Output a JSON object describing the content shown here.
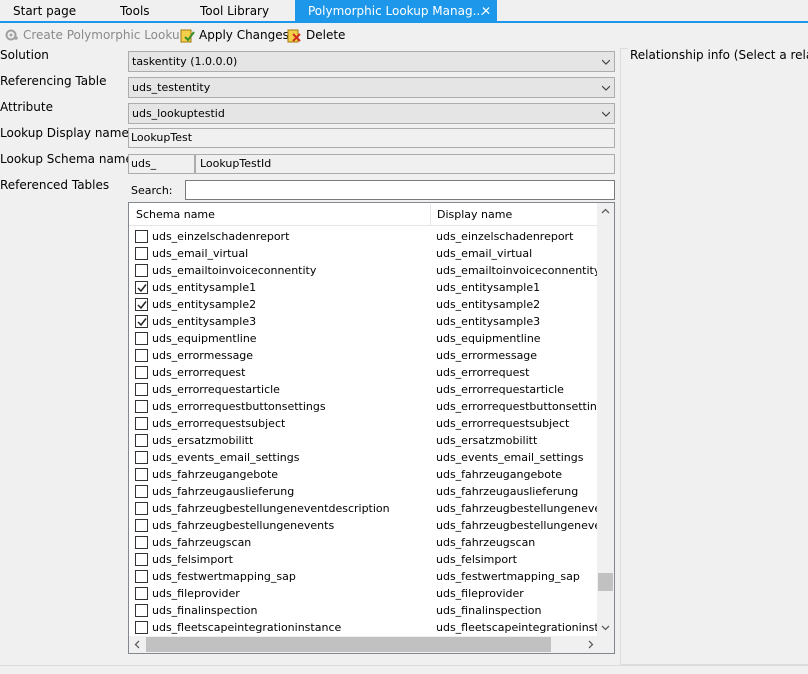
{
  "tabs": [
    {
      "label": "Start page",
      "active": false
    },
    {
      "label": "Tools",
      "active": false
    },
    {
      "label": "Tool Library",
      "active": false
    },
    {
      "label": "Polymorphic Lookup Manag...",
      "active": true
    }
  ],
  "toolbar": {
    "create_label": "Create Polymorphic Lookup",
    "apply_label": "Apply Changes",
    "delete_label": "Delete"
  },
  "form": {
    "solution_label": "Solution",
    "solution_value": "taskentity (1.0.0.0)",
    "referencing_label": "Referencing Table",
    "referencing_value": "uds_testentity",
    "attribute_label": "Attribute",
    "attribute_value": "uds_lookuptestid",
    "display_name_label": "Lookup Display name",
    "display_name_value": "LookupTest",
    "schema_name_label": "Lookup Schema name",
    "schema_prefix": "uds_",
    "schema_name_value": "LookupTestId",
    "referenced_tables_label": "Referenced Tables",
    "search_label": "Search:",
    "search_value": ""
  },
  "list": {
    "columns": [
      "Schema name",
      "Display name"
    ],
    "rows": [
      {
        "schema": "uds_einzelschadenreport",
        "display": "uds_einzelschadenreport",
        "checked": false
      },
      {
        "schema": "uds_email_virtual",
        "display": "uds_email_virtual",
        "checked": false
      },
      {
        "schema": "uds_emailtoinvoiceconnentity",
        "display": "uds_emailtoinvoiceconnentity",
        "checked": false
      },
      {
        "schema": "uds_entitysample1",
        "display": "uds_entitysample1",
        "checked": true
      },
      {
        "schema": "uds_entitysample2",
        "display": "uds_entitysample2",
        "checked": true
      },
      {
        "schema": "uds_entitysample3",
        "display": "uds_entitysample3",
        "checked": true
      },
      {
        "schema": "uds_equipmentline",
        "display": "uds_equipmentline",
        "checked": false
      },
      {
        "schema": "uds_errormessage",
        "display": "uds_errormessage",
        "checked": false
      },
      {
        "schema": "uds_errorrequest",
        "display": "uds_errorrequest",
        "checked": false
      },
      {
        "schema": "uds_errorrequestarticle",
        "display": "uds_errorrequestarticle",
        "checked": false
      },
      {
        "schema": "uds_errorrequestbuttonsettings",
        "display": "uds_errorrequestbuttonsettings",
        "checked": false
      },
      {
        "schema": "uds_errorrequestsubject",
        "display": "uds_errorrequestsubject",
        "checked": false
      },
      {
        "schema": "uds_ersatzmobilitt",
        "display": "uds_ersatzmobilitt",
        "checked": false
      },
      {
        "schema": "uds_events_email_settings",
        "display": "uds_events_email_settings",
        "checked": false
      },
      {
        "schema": "uds_fahrzeugangebote",
        "display": "uds_fahrzeugangebote",
        "checked": false
      },
      {
        "schema": "uds_fahrzeugauslieferung",
        "display": "uds_fahrzeugauslieferung",
        "checked": false
      },
      {
        "schema": "uds_fahrzeugbestellungeneventdescription",
        "display": "uds_fahrzeugbestellungeneventde",
        "checked": false
      },
      {
        "schema": "uds_fahrzeugbestellungenevents",
        "display": "uds_fahrzeugbestellungenevents",
        "checked": false
      },
      {
        "schema": "uds_fahrzeugscan",
        "display": "uds_fahrzeugscan",
        "checked": false
      },
      {
        "schema": "uds_felsimport",
        "display": "uds_felsimport",
        "checked": false
      },
      {
        "schema": "uds_festwertmapping_sap",
        "display": "uds_festwertmapping_sap",
        "checked": false
      },
      {
        "schema": "uds_fileprovider",
        "display": "uds_fileprovider",
        "checked": false
      },
      {
        "schema": "uds_finalinspection",
        "display": "uds_finalinspection",
        "checked": false
      },
      {
        "schema": "uds_fleetscapeintegrationinstance",
        "display": "uds_fleetscapeintegrationinstance",
        "checked": false
      }
    ]
  },
  "relationship_info_title": "Relationship info (Select a relationship",
  "colors": {
    "accent": "#1c97ea",
    "background": "#f0f0f0"
  }
}
